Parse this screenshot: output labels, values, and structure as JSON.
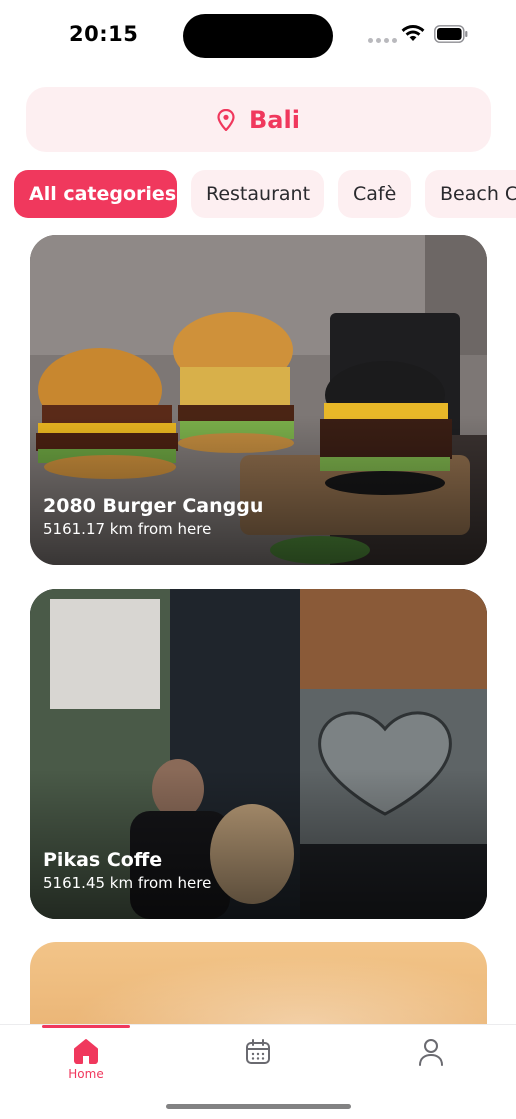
{
  "status_bar": {
    "time": "20:15"
  },
  "location": {
    "label": "Bali",
    "icon": "map-pin-icon"
  },
  "categories": [
    {
      "label": "All categories",
      "active": true
    },
    {
      "label": "Restaurant",
      "active": false
    },
    {
      "label": "Cafè",
      "active": false
    },
    {
      "label": "Beach Club",
      "active": false
    }
  ],
  "places": [
    {
      "name": "2080 Burger Canggu",
      "distance": "5161.17 km from here"
    },
    {
      "name": "Pikas Coffe",
      "distance": "5161.45 km from here"
    }
  ],
  "tab_bar": {
    "home_label": "Home",
    "active_tab": "home",
    "accent_color": "#f0385d"
  },
  "colors": {
    "accent": "#f0385d",
    "chip_background": "#fdeff1"
  }
}
